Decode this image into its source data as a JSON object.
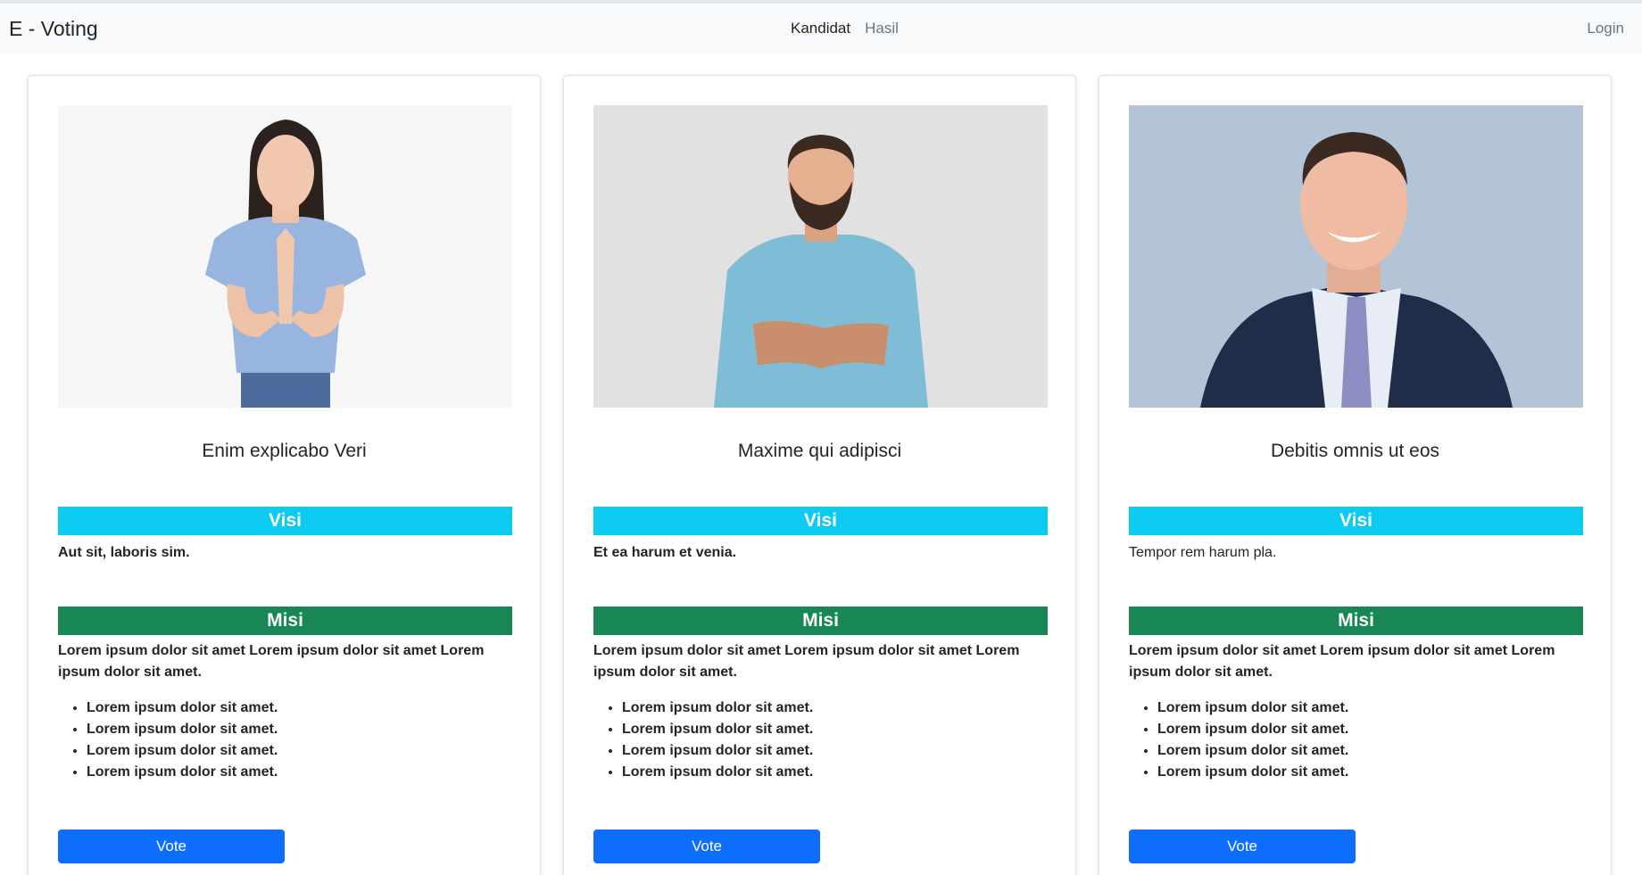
{
  "navbar": {
    "brand": "E - Voting",
    "links": [
      "Kandidat",
      "Hasil"
    ],
    "login": "Login"
  },
  "candidates": [
    {
      "name": "Enim explicabo Veri",
      "visi_label": "Visi",
      "visi": "Aut sit, laboris sim.",
      "misi_label": "Misi",
      "misi": "Lorem ipsum dolor sit amet Lorem ipsum dolor sit amet Lorem ipsum dolor sit amet.",
      "misi_items": [
        "Lorem ipsum dolor sit amet.",
        "Lorem ipsum dolor sit amet.",
        "Lorem ipsum dolor sit amet.",
        "Lorem ipsum dolor sit amet."
      ],
      "vote_label": "Vote"
    },
    {
      "name": "Maxime qui adipisci",
      "visi_label": "Visi",
      "visi": "Et ea harum et venia.",
      "misi_label": "Misi",
      "misi": "Lorem ipsum dolor sit amet Lorem ipsum dolor sit amet Lorem ipsum dolor sit amet.",
      "misi_items": [
        "Lorem ipsum dolor sit amet.",
        "Lorem ipsum dolor sit amet.",
        "Lorem ipsum dolor sit amet.",
        "Lorem ipsum dolor sit amet."
      ],
      "vote_label": "Vote"
    },
    {
      "name": "Debitis omnis ut eos",
      "visi_label": "Visi",
      "visi": "Tempor rem harum pla.",
      "misi_label": "Misi",
      "misi": "Lorem ipsum dolor sit amet Lorem ipsum dolor sit amet Lorem ipsum dolor sit amet.",
      "misi_items": [
        "Lorem ipsum dolor sit amet.",
        "Lorem ipsum dolor sit amet.",
        "Lorem ipsum dolor sit amet.",
        "Lorem ipsum dolor sit amet."
      ],
      "vote_label": "Vote"
    }
  ],
  "colors": {
    "visi": "#0dcaf0",
    "misi": "#198754",
    "vote": "#0d6efd",
    "navbar": "#f8f9fa"
  }
}
